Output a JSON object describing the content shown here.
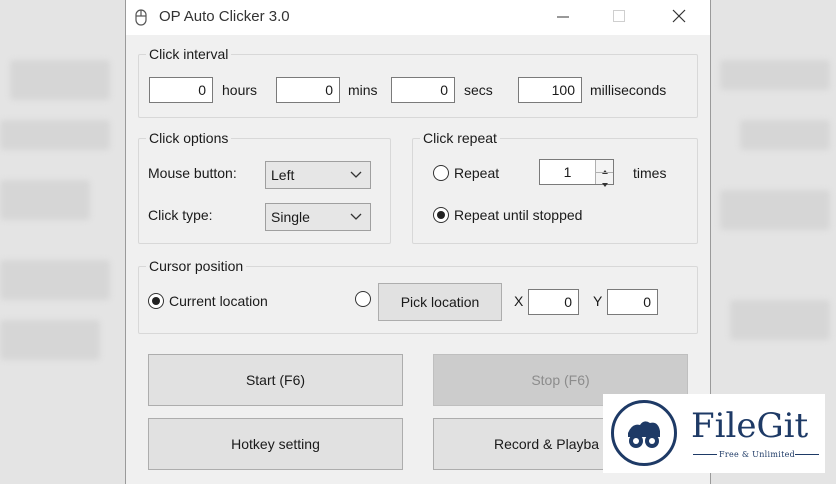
{
  "window": {
    "title": "OP Auto Clicker 3.0"
  },
  "click_interval": {
    "title": "Click interval",
    "hours_value": "0",
    "hours_label": "hours",
    "mins_value": "0",
    "mins_label": "mins",
    "secs_value": "0",
    "secs_label": "secs",
    "ms_value": "100",
    "ms_label": "milliseconds"
  },
  "click_options": {
    "title": "Click options",
    "mouse_button_label": "Mouse button:",
    "mouse_button_value": "Left",
    "click_type_label": "Click type:",
    "click_type_value": "Single"
  },
  "click_repeat": {
    "title": "Click repeat",
    "repeat_label": "Repeat",
    "repeat_count": "1",
    "times_label": "times",
    "until_stopped_label": "Repeat until stopped",
    "selected": "until_stopped"
  },
  "cursor_position": {
    "title": "Cursor position",
    "current_location_label": "Current location",
    "pick_location_label": "Pick location",
    "x_label": "X",
    "x_value": "0",
    "y_label": "Y",
    "y_value": "0",
    "selected": "current"
  },
  "buttons": {
    "start": "Start (F6)",
    "stop": "Stop (F6)",
    "hotkey": "Hotkey setting",
    "record": "Record & Playba"
  },
  "watermark": {
    "name": "FileGit",
    "tagline": "Free & Unlimited"
  },
  "colors": {
    "window_bg": "#f0f0f0",
    "watermark": "#1e3a66",
    "disabled_button": "#cccccc"
  }
}
